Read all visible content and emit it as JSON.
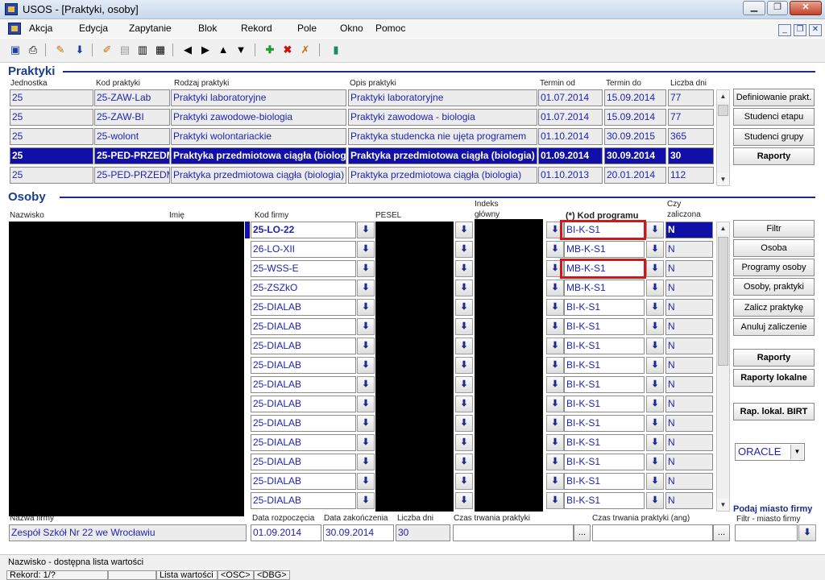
{
  "window": {
    "title": "USOS - [Praktyki, osoby]"
  },
  "menu": [
    "Akcja",
    "Edycja",
    "Zapytanie",
    "Blok",
    "Rekord",
    "Pole",
    "Okno",
    "Pomoc"
  ],
  "praktyki": {
    "section_title": "Praktyki",
    "headers": [
      "Jednostka",
      "Kod praktyki",
      "Rodzaj praktyki",
      "Opis praktyki",
      "Termin od",
      "Termin do",
      "Liczba dni"
    ],
    "rows": [
      [
        "25",
        "25-ZAW-Lab",
        "Praktyki laboratoryjne",
        "Praktyki laboratoryjne",
        "01.07.2014",
        "15.09.2014",
        "77"
      ],
      [
        "25",
        "25-ZAW-BI",
        "Praktyki zawodowe-biologia",
        "Praktyki zawodowa - biologia",
        "01.07.2014",
        "15.09.2014",
        "77"
      ],
      [
        "25",
        "25-wolont",
        "Praktyki wolontariackie",
        "Praktyka studencka nie ujęta programem",
        "01.10.2014",
        "30.09.2015",
        "365"
      ],
      [
        "25",
        "25-PED-PRZEDM",
        "Praktyka przedmiotowa ciągła (biologia)",
        "Praktyka przedmiotowa ciągła (biologia)",
        "01.09.2014",
        "30.09.2014",
        "30"
      ],
      [
        "25",
        "25-PED-PRZEDM",
        "Praktyka przedmiotowa ciągła (biologia)",
        "Praktyka przedmiotowa ciągła (biologia)",
        "01.10.2013",
        "20.01.2014",
        "112"
      ]
    ],
    "selected_index": 3,
    "buttons": [
      "Definiowanie prakt.",
      "Studenci etapu",
      "Studenci grupy",
      "Raporty"
    ]
  },
  "osoby": {
    "section_title": "Osoby",
    "headers": {
      "nazwisko": "Nazwisko",
      "imie": "Imię",
      "kod_firmy": "Kod firmy",
      "pesel": "PESEL",
      "indeks_1": "Indeks",
      "indeks_2": "główny",
      "kod_programu": "(*) Kod programu",
      "czy_1": "Czy",
      "czy_2": "zaliczona"
    },
    "rows": [
      {
        "kod_firmy": "25-LO-22",
        "kod_programu": "BI-K-S1",
        "zal": "N"
      },
      {
        "kod_firmy": "26-LO-XII",
        "kod_programu": "MB-K-S1",
        "zal": "N"
      },
      {
        "kod_firmy": "25-WSS-E",
        "kod_programu": "MB-K-S1",
        "zal": "N"
      },
      {
        "kod_firmy": "25-ZSZkO",
        "kod_programu": "MB-K-S1",
        "zal": "N"
      },
      {
        "kod_firmy": "25-DIALAB",
        "kod_programu": "BI-K-S1",
        "zal": "N"
      },
      {
        "kod_firmy": "25-DIALAB",
        "kod_programu": "BI-K-S1",
        "zal": "N"
      },
      {
        "kod_firmy": "25-DIALAB",
        "kod_programu": "BI-K-S1",
        "zal": "N"
      },
      {
        "kod_firmy": "25-DIALAB",
        "kod_programu": "BI-K-S1",
        "zal": "N"
      },
      {
        "kod_firmy": "25-DIALAB",
        "kod_programu": "BI-K-S1",
        "zal": "N"
      },
      {
        "kod_firmy": "25-DIALAB",
        "kod_programu": "BI-K-S1",
        "zal": "N"
      },
      {
        "kod_firmy": "25-DIALAB",
        "kod_programu": "BI-K-S1",
        "zal": "N"
      },
      {
        "kod_firmy": "25-DIALAB",
        "kod_programu": "BI-K-S1",
        "zal": "N"
      },
      {
        "kod_firmy": "25-DIALAB",
        "kod_programu": "BI-K-S1",
        "zal": "N"
      },
      {
        "kod_firmy": "25-DIALAB",
        "kod_programu": "BI-K-S1",
        "zal": "N"
      },
      {
        "kod_firmy": "25-DIALAB",
        "kod_programu": "BI-K-S1",
        "zal": "N"
      }
    ],
    "buttons": [
      "Filtr",
      "Osoba",
      "Programy osoby",
      "Osoby, praktyki",
      "Zalicz praktykę",
      "Anuluj zaliczenie"
    ],
    "buttons2": [
      "Raporty",
      "Raporty lokalne"
    ],
    "birt_button": "Rap. lokal. BIRT",
    "db_select": "ORACLE"
  },
  "detail": {
    "nazwa_firmy_label": "Nazwa firmy",
    "nazwa_firmy": "Zespół Szkół Nr 22 we Wrocławiu",
    "data_rozp_label": "Data rozpoczęcia",
    "data_rozp": "01.09.2014",
    "data_zak_label": "Data zakończenia",
    "data_zak": "30.09.2014",
    "liczba_dni_label": "Liczba dni",
    "liczba_dni": "30",
    "czas_label": "Czas trwania praktyki",
    "czas_ang_label": "Czas trwania praktyki (ang)",
    "podaj_miasto": "Podaj miasto firmy",
    "filtr_miasto_label": "Filtr - miasto firmy",
    "ellipsis": "..."
  },
  "status": {
    "hint": "Nazwisko - dostępna lista wartości",
    "rekord": "Rekord: 1/?",
    "lista": "Lista wartości",
    "osc": "<OSC>",
    "dbg": "<DBG>"
  }
}
